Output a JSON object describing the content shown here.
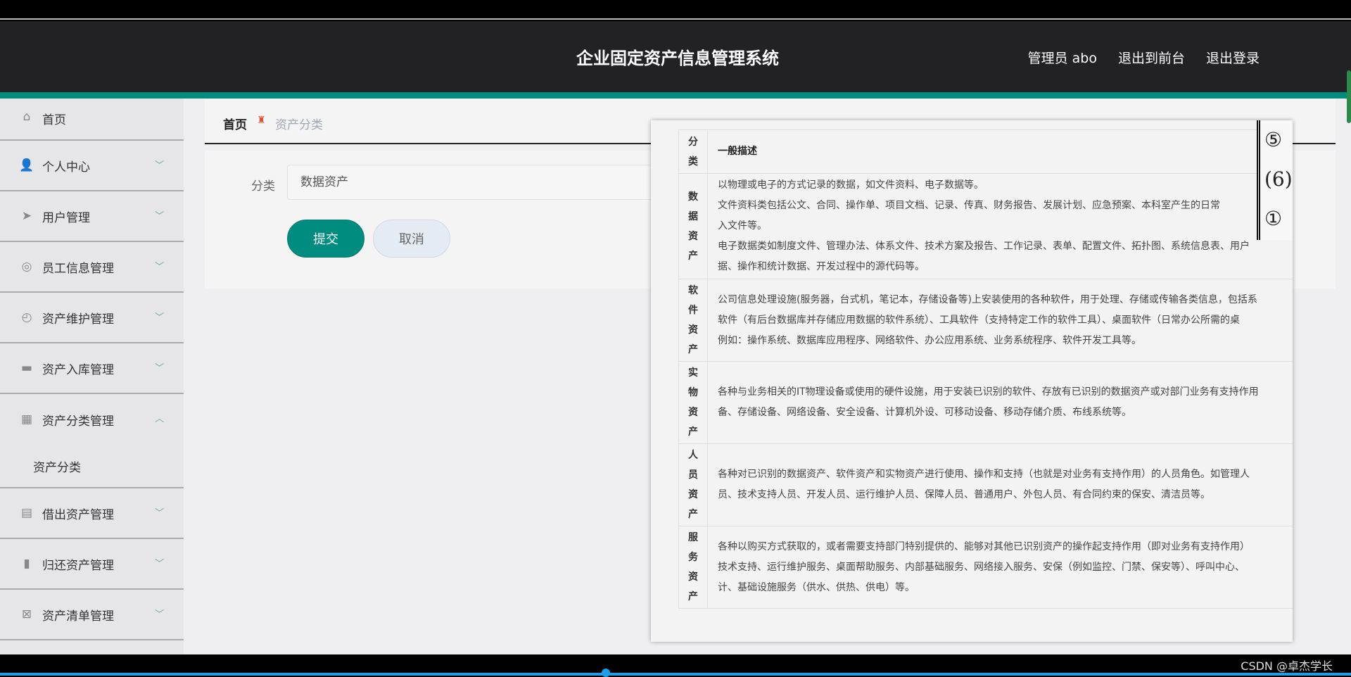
{
  "header": {
    "title": "企业固定资产信息管理系统",
    "user": "管理员 abo",
    "to_front": "退出到前台",
    "logout": "退出登录"
  },
  "sidebar": {
    "items": [
      {
        "label": "首页",
        "icon": "home-icon",
        "glyph": "⌂"
      },
      {
        "label": "个人中心",
        "icon": "user-icon",
        "glyph": "👤"
      },
      {
        "label": "用户管理",
        "icon": "paper-plane-icon",
        "glyph": "➤"
      },
      {
        "label": "员工信息管理",
        "icon": "lifebuoy-icon",
        "glyph": "◎"
      },
      {
        "label": "资产维护管理",
        "icon": "gauge-icon",
        "glyph": "◴"
      },
      {
        "label": "资产入库管理",
        "icon": "monitor-icon",
        "glyph": "▬"
      },
      {
        "label": "资产分类管理",
        "icon": "grid-icon",
        "glyph": "▦",
        "expanded": true,
        "sub": "资产分类"
      },
      {
        "label": "借出资产管理",
        "icon": "clipboard-icon",
        "glyph": "▤"
      },
      {
        "label": "归还资产管理",
        "icon": "book-icon",
        "glyph": "▮"
      },
      {
        "label": "资产清单管理",
        "icon": "clipboard-x-icon",
        "glyph": "⊠"
      }
    ]
  },
  "breadcrumb": {
    "home": "首页",
    "current": "资产分类"
  },
  "form": {
    "label": "分类",
    "value": "数据资产",
    "submit": "提交",
    "cancel": "取消"
  },
  "popup": {
    "header": {
      "cat": "分类",
      "desc": "一般描述"
    },
    "rows": [
      {
        "cat": "数据资产",
        "lines": [
          "以物理或电子的方式记录的数据，如文件资料、电子数据等。",
          "文件资料类包括公文、合同、操作单、项目文档、记录、传真、财务报告、发展计划、应急预案、本科室产生的日常",
          "入文件等。",
          "电子数据类如制度文件、管理办法、体系文件、技术方案及报告、工作记录、表单、配置文件、拓扑图、系统信息表、用户",
          "据、操作和统计数据、开发过程中的源代码等。"
        ]
      },
      {
        "cat": "软件资产",
        "lines": [
          "公司信息处理设施(服务器，台式机，笔记本，存储设备等)上安装使用的各种软件，用于处理、存储或传输各类信息，包括系",
          "软件（有后台数据库并存储应用数据的软件系统）、工具软件（支持特定工作的软件工具）、桌面软件（日常办公所需的桌",
          "例如：操作系统、数据库应用程序、网络软件、办公应用系统、业务系统程序、软件开发工具等。"
        ]
      },
      {
        "cat": "实物资产",
        "lines": [
          "各种与业务相关的IT物理设备或使用的硬件设施，用于安装已识别的软件、存放有已识别的数据资产或对部门业务有支持作用",
          "备、存储设备、网络设备、安全设备、计算机外设、可移动设备、移动存储介质、布线系统等。"
        ]
      },
      {
        "cat": "人员资产",
        "lines": [
          "各种对已识别的数据资产、软件资产和实物资产进行使用、操作和支持（也就是对业务有支持作用）的人员角色。如管理人",
          "员、技术支持人员、开发人员、运行维护人员、保障人员、普通用户、外包人员、有合同约束的保安、清洁员等。"
        ]
      },
      {
        "cat": "服务资产",
        "lines": [
          "各种以购买方式获取的，或者需要支持部门特别提供的、能够对其他已识别资产的操作起支持作用（即对业务有支持作用）",
          "技术支持、运行维护服务、桌面帮助服务、内部基础服务、网络接入服务、安保（例如监控、门禁、保安等）、呼叫中心、",
          "计、基础设施服务（供水、供热、供电）等。"
        ]
      }
    ],
    "side_marks": [
      "⑤",
      "(6)",
      "①"
    ]
  },
  "watermark": "CSDN @卓杰学长"
}
